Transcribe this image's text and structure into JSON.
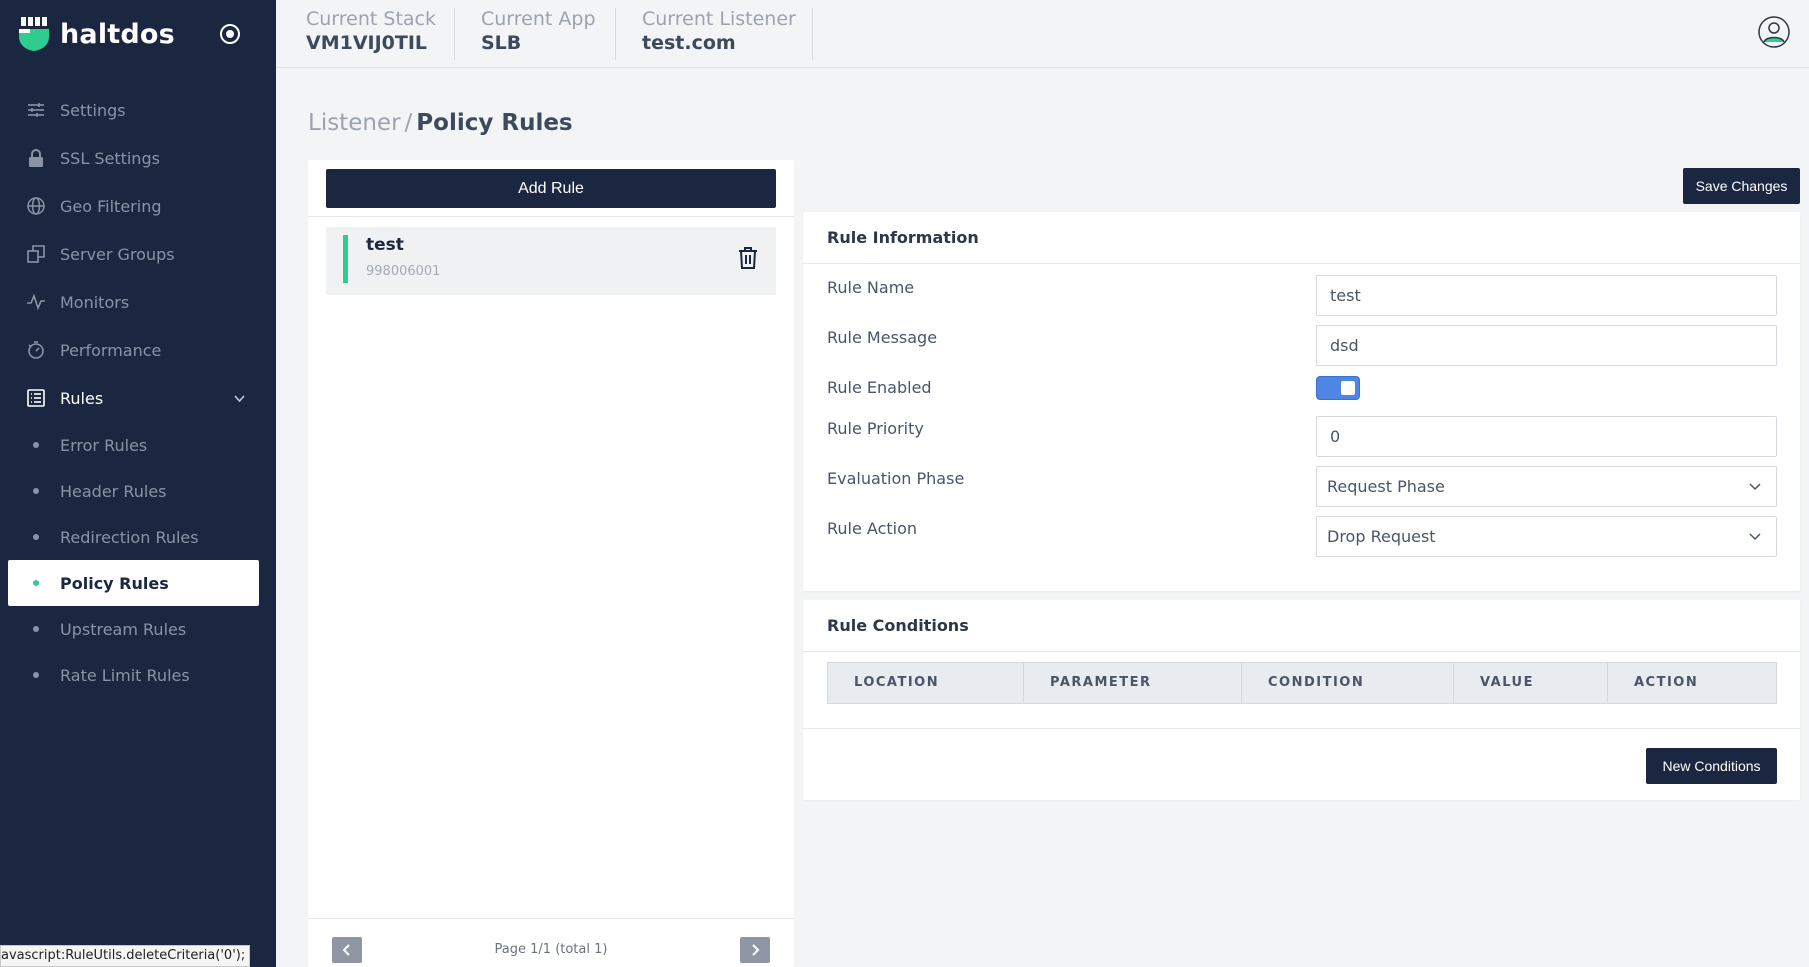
{
  "brand": {
    "name": "haltdos"
  },
  "sidebar": {
    "items": [
      {
        "label": "Settings",
        "icon": "sliders-icon"
      },
      {
        "label": "SSL Settings",
        "icon": "lock-icon"
      },
      {
        "label": "Geo Filtering",
        "icon": "globe-icon"
      },
      {
        "label": "Server Groups",
        "icon": "copy-icon"
      },
      {
        "label": "Monitors",
        "icon": "activity-icon"
      },
      {
        "label": "Performance",
        "icon": "stopwatch-icon"
      },
      {
        "label": "Rules",
        "icon": "list-icon"
      }
    ],
    "rules_children": [
      "Error Rules",
      "Header Rules",
      "Redirection Rules",
      "Policy Rules",
      "Upstream Rules",
      "Rate Limit Rules"
    ],
    "active_child": "Policy Rules"
  },
  "header": {
    "stack_label": "Current Stack",
    "stack_value": "VM1VIJ0TIL",
    "app_label": "Current App",
    "app_value": "SLB",
    "listener_label": "Current Listener",
    "listener_value": "test.com"
  },
  "breadcrumb": {
    "parent": "Listener",
    "separator": "/",
    "current": "Policy Rules"
  },
  "rules_list": {
    "add_label": "Add Rule",
    "items": [
      {
        "title": "test",
        "id": "998006001"
      }
    ],
    "pager_text": "Page 1/1 (total 1)"
  },
  "actions": {
    "save_label": "Save Changes",
    "new_conditions_label": "New Conditions"
  },
  "rule_info": {
    "title": "Rule Information",
    "name_label": "Rule Name",
    "name_value": "test",
    "message_label": "Rule Message",
    "message_value": "dsd",
    "enabled_label": "Rule Enabled",
    "enabled": true,
    "priority_label": "Rule Priority",
    "priority_value": "0",
    "phase_label": "Evaluation Phase",
    "phase_value": "Request Phase",
    "action_label": "Rule Action",
    "action_value": "Drop Request"
  },
  "rule_conditions": {
    "title": "Rule Conditions",
    "columns": [
      "LOCATION",
      "PARAMETER",
      "CONDITION",
      "VALUE",
      "ACTION"
    ]
  },
  "status_bar": "avascript:RuleUtils.deleteCriteria('0');",
  "colors": {
    "sidebar": "#1b2640",
    "accent": "#2ecc8f",
    "toggle": "#4f86e3"
  }
}
